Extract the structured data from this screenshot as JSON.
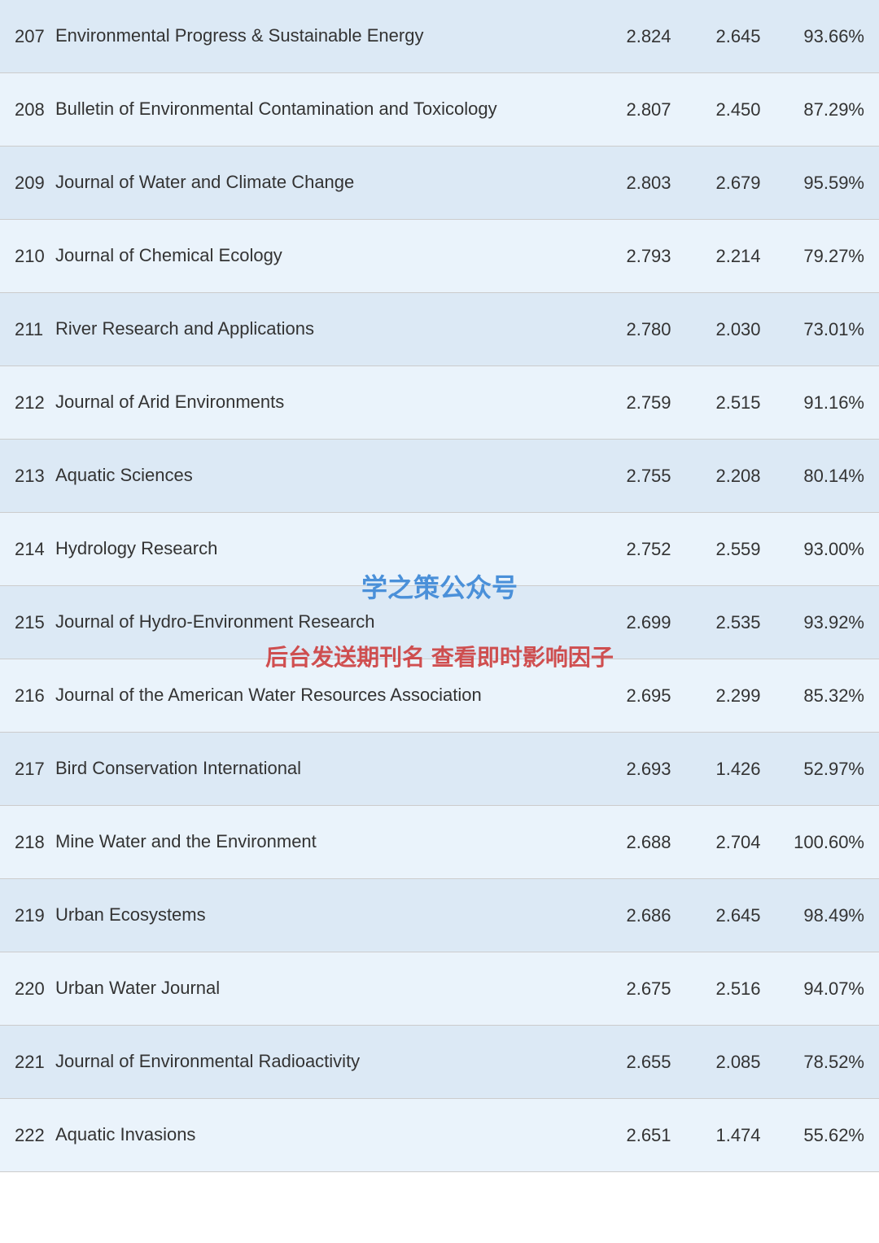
{
  "watermark1": "学之策公众号",
  "watermark2": "后台发送期刊名 查看即时影响因子",
  "rows": [
    {
      "rank": "207",
      "name": "Environmental Progress & Sustainable Energy",
      "if": "2.824",
      "if5": "2.645",
      "pct": "93.66%"
    },
    {
      "rank": "208",
      "name": "Bulletin of Environmental Contamination and Toxicology",
      "if": "2.807",
      "if5": "2.450",
      "pct": "87.29%"
    },
    {
      "rank": "209",
      "name": "Journal of Water and Climate Change",
      "if": "2.803",
      "if5": "2.679",
      "pct": "95.59%"
    },
    {
      "rank": "210",
      "name": "Journal of Chemical Ecology",
      "if": "2.793",
      "if5": "2.214",
      "pct": "79.27%"
    },
    {
      "rank": "211",
      "name": "River Research and Applications",
      "if": "2.780",
      "if5": "2.030",
      "pct": "73.01%"
    },
    {
      "rank": "212",
      "name": "Journal of Arid Environments",
      "if": "2.759",
      "if5": "2.515",
      "pct": "91.16%"
    },
    {
      "rank": "213",
      "name": "Aquatic Sciences",
      "if": "2.755",
      "if5": "2.208",
      "pct": "80.14%"
    },
    {
      "rank": "214",
      "name": "Hydrology Research",
      "if": "2.752",
      "if5": "2.559",
      "pct": "93.00%"
    },
    {
      "rank": "215",
      "name": "Journal of Hydro-Environment Research",
      "if": "2.699",
      "if5": "2.535",
      "pct": "93.92%"
    },
    {
      "rank": "216",
      "name": "Journal of the American Water Resources Association",
      "if": "2.695",
      "if5": "2.299",
      "pct": "85.32%"
    },
    {
      "rank": "217",
      "name": "Bird Conservation International",
      "if": "2.693",
      "if5": "1.426",
      "pct": "52.97%"
    },
    {
      "rank": "218",
      "name": "Mine Water and the Environment",
      "if": "2.688",
      "if5": "2.704",
      "pct": "100.60%"
    },
    {
      "rank": "219",
      "name": "Urban Ecosystems",
      "if": "2.686",
      "if5": "2.645",
      "pct": "98.49%"
    },
    {
      "rank": "220",
      "name": "Urban Water Journal",
      "if": "2.675",
      "if5": "2.516",
      "pct": "94.07%"
    },
    {
      "rank": "221",
      "name": "Journal of Environmental Radioactivity",
      "if": "2.655",
      "if5": "2.085",
      "pct": "78.52%"
    },
    {
      "rank": "222",
      "name": "Aquatic Invasions",
      "if": "2.651",
      "if5": "1.474",
      "pct": "55.62%"
    }
  ]
}
